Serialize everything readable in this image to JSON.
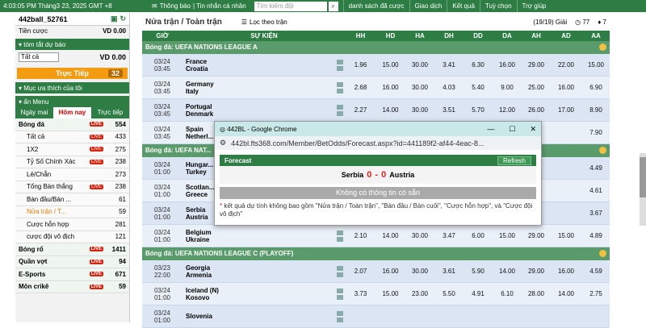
{
  "topbar": {
    "datetime": "4:03:05 PM Tháng3 23, 2025 GMT +8",
    "notifications": "Thông báo",
    "messages": "| Tin nhắn cá nhân",
    "search_placeholder": "Tìm kiếm đội",
    "nav": [
      "danh sách đã cược",
      "Giao dịch",
      "Kết quả",
      "Tuỳ chọn",
      "Trợ giúp"
    ]
  },
  "account": {
    "username": "442ball_52761",
    "credit_label": "Tiền cược",
    "credit_value": "VD 0.00"
  },
  "summary": {
    "title": "tóm tắt dự báo",
    "select": "Tất cả",
    "value": "VD 0.00"
  },
  "live": {
    "label": "Trực Tiếp",
    "count": "32"
  },
  "fav": {
    "title": "Mục ưa thích của tôi"
  },
  "menu": {
    "title": "ẩn Menu",
    "tabs": [
      "Ngày mai",
      "Hôm nay",
      "Trực tiếp"
    ]
  },
  "live_badge": "LIVE",
  "items": [
    {
      "label": "Bóng đá",
      "count": "554",
      "live": true,
      "sport": true
    },
    {
      "label": "Tất cả",
      "count": "433",
      "live": true
    },
    {
      "label": "1X2",
      "count": "275",
      "live": true
    },
    {
      "label": "Tỷ Số Chính Xác",
      "count": "238",
      "live": true
    },
    {
      "label": "Lẻ/Chẵn",
      "count": "273",
      "live": false
    },
    {
      "label": "Tổng Bàn thắng",
      "count": "238",
      "live": true
    },
    {
      "label": "Bàn đầu/Bàn ...",
      "count": "61",
      "live": false
    },
    {
      "label": "Nửa trận / T...",
      "count": "59",
      "live": false,
      "hl": true
    },
    {
      "label": "Cược hỗn hợp",
      "count": "281",
      "live": false
    },
    {
      "label": "cược đội vô địch",
      "count": "121",
      "live": false
    },
    {
      "label": "Bóng rổ",
      "count": "1411",
      "live": true,
      "sport": true
    },
    {
      "label": "Quần vợt",
      "count": "94",
      "live": true,
      "sport": true
    },
    {
      "label": "E-Sports",
      "count": "671",
      "live": true,
      "sport": true
    },
    {
      "label": "Môn crikê",
      "count": "59",
      "live": true,
      "sport": true
    }
  ],
  "main": {
    "title": "Nửa trận / Toàn trận",
    "filter": "Lọc theo trận",
    "page": "(19/19) Giải",
    "count1": "77",
    "count2": "7"
  },
  "columns": [
    "GIỜ",
    "SỰ KIỆN",
    "HH",
    "HD",
    "HA",
    "DH",
    "DD",
    "DA",
    "AH",
    "AD",
    "AA"
  ],
  "leagues": [
    {
      "name": "Bóng đá: UEFA NATIONS LEAGUE A",
      "matches": [
        {
          "date": "03/24",
          "time": "03:45",
          "home": "France",
          "away": "Croatia",
          "odds": [
            "1.96",
            "15.00",
            "30.00",
            "3.41",
            "6.30",
            "16.00",
            "29.00",
            "22.00",
            "15.00"
          ]
        },
        {
          "date": "03/24",
          "time": "03:45",
          "home": "Germany",
          "away": "Italy",
          "odds": [
            "2.68",
            "16.00",
            "30.00",
            "4.03",
            "5.40",
            "9.00",
            "25.00",
            "16.00",
            "6.90"
          ]
        },
        {
          "date": "03/24",
          "time": "03:45",
          "home": "Portugal",
          "away": "Denmark",
          "odds": [
            "2.27",
            "14.00",
            "30.00",
            "3.51",
            "5.70",
            "12.00",
            "26.00",
            "17.00",
            "8.90"
          ]
        },
        {
          "date": "03/24",
          "time": "03:45",
          "home": "Spain",
          "away": "Netherl...",
          "odds": [
            "",
            "",
            "",
            "",
            "",
            "",
            "",
            "",
            "7.90"
          ]
        }
      ]
    },
    {
      "name": "Bóng đá: UEFA NAT...",
      "matches": [
        {
          "date": "03/24",
          "time": "01:00",
          "home": "Hungar...",
          "away": "Turkey",
          "odds": [
            "",
            "",
            "",
            "",
            "",
            "",
            "",
            "",
            "4.49"
          ]
        },
        {
          "date": "03/24",
          "time": "01:00",
          "home": "Scotlan...",
          "away": "Greece",
          "odds": [
            "",
            "",
            "",
            "",
            "",
            "",
            "",
            "",
            "4.61"
          ]
        },
        {
          "date": "03/24",
          "time": "01:00",
          "home": "Serbia",
          "away": "Austria",
          "odds": [
            "",
            "",
            "",
            "",
            "",
            "",
            "",
            "",
            "3.67"
          ]
        },
        {
          "date": "03/24",
          "time": "01:00",
          "home": "Belgium",
          "away": "Ukraine",
          "odds": [
            "2.10",
            "14.00",
            "30.00",
            "3.47",
            "6.00",
            "15.00",
            "29.00",
            "15.00",
            "4.89"
          ]
        }
      ]
    },
    {
      "name": "Bóng đá: UEFA NATIONS LEAGUE C (PLAYOFF)",
      "matches": [
        {
          "date": "03/23",
          "time": "22:00",
          "home": "Georgia",
          "away": "Armenia",
          "odds": [
            "2.07",
            "16.00",
            "30.00",
            "3.61",
            "5.90",
            "14.00",
            "29.00",
            "16.00",
            "4.59"
          ]
        },
        {
          "date": "03/24",
          "time": "01:00",
          "home": "Iceland (N)",
          "away": "Kosovo",
          "odds": [
            "3.73",
            "15.00",
            "23.00",
            "5.50",
            "4.91",
            "6.10",
            "28.00",
            "14.00",
            "2.75"
          ]
        },
        {
          "date": "03/24",
          "time": "01:00",
          "home": "Slovenia",
          "away": "",
          "odds": [
            "",
            "",
            "",
            "",
            "",
            "",
            "",
            "",
            ""
          ]
        }
      ]
    }
  ],
  "popup": {
    "title": "442BL - Google Chrome",
    "url": "442bl.fts368.com/Member/BetOdds/Forecast.aspx?id=441189f2-af44-4eac-8...",
    "header": "Forecast",
    "refresh": "Refresh",
    "home": "Serbia",
    "home_score": "0",
    "sep": "-",
    "away_score": "0",
    "away": "Austria",
    "nodata": "Không có thông tin có sẵn",
    "note": "kết quả dự tính không bao gồm \"Nửa trận / Toàn trận\", \"Bàn đầu / Bàn cuối\", \"Cược hỗn hợp\", và \"Cược đội vô địch\""
  }
}
